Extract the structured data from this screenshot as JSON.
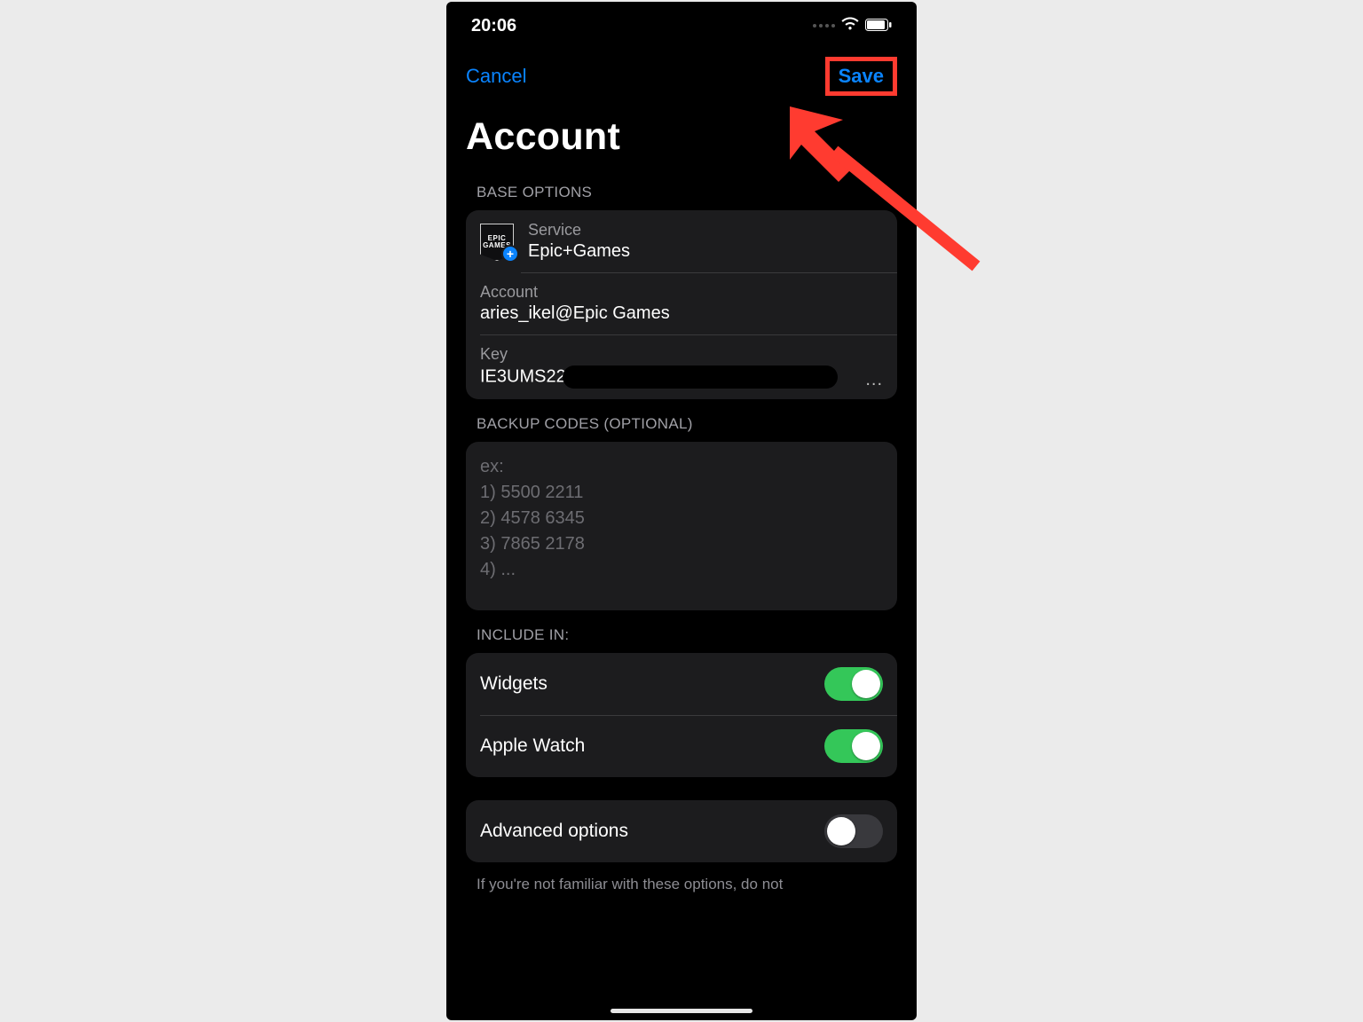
{
  "status": {
    "time": "20:06"
  },
  "nav": {
    "cancel": "Cancel",
    "save": "Save"
  },
  "title": "Account",
  "sections": {
    "base_label": "BASE OPTIONS",
    "backup_label": "BACKUP CODES (OPTIONAL)",
    "include_label": "INCLUDE IN:"
  },
  "service": {
    "label": "Service",
    "value": "Epic+Games",
    "logo_top": "EPIC",
    "logo_bottom": "GAMES"
  },
  "account": {
    "label": "Account",
    "value": "aries_ikel@Epic Games"
  },
  "key": {
    "label": "Key",
    "value_prefix": "IE3UMS22",
    "ellipsis": "..."
  },
  "backup_placeholder": "ex:\n1) 5500 2211\n2) 4578 6345\n3) 7865 2178\n4) ...",
  "toggles": {
    "widgets": {
      "label": "Widgets",
      "on": true
    },
    "apple_watch": {
      "label": "Apple Watch",
      "on": true
    },
    "advanced": {
      "label": "Advanced options",
      "on": false
    }
  },
  "footer_note": "If you're not familiar with these options, do not",
  "colors": {
    "accent": "#0a84ff",
    "toggle_on": "#34c759",
    "annotation_red": "#ff3b30"
  }
}
